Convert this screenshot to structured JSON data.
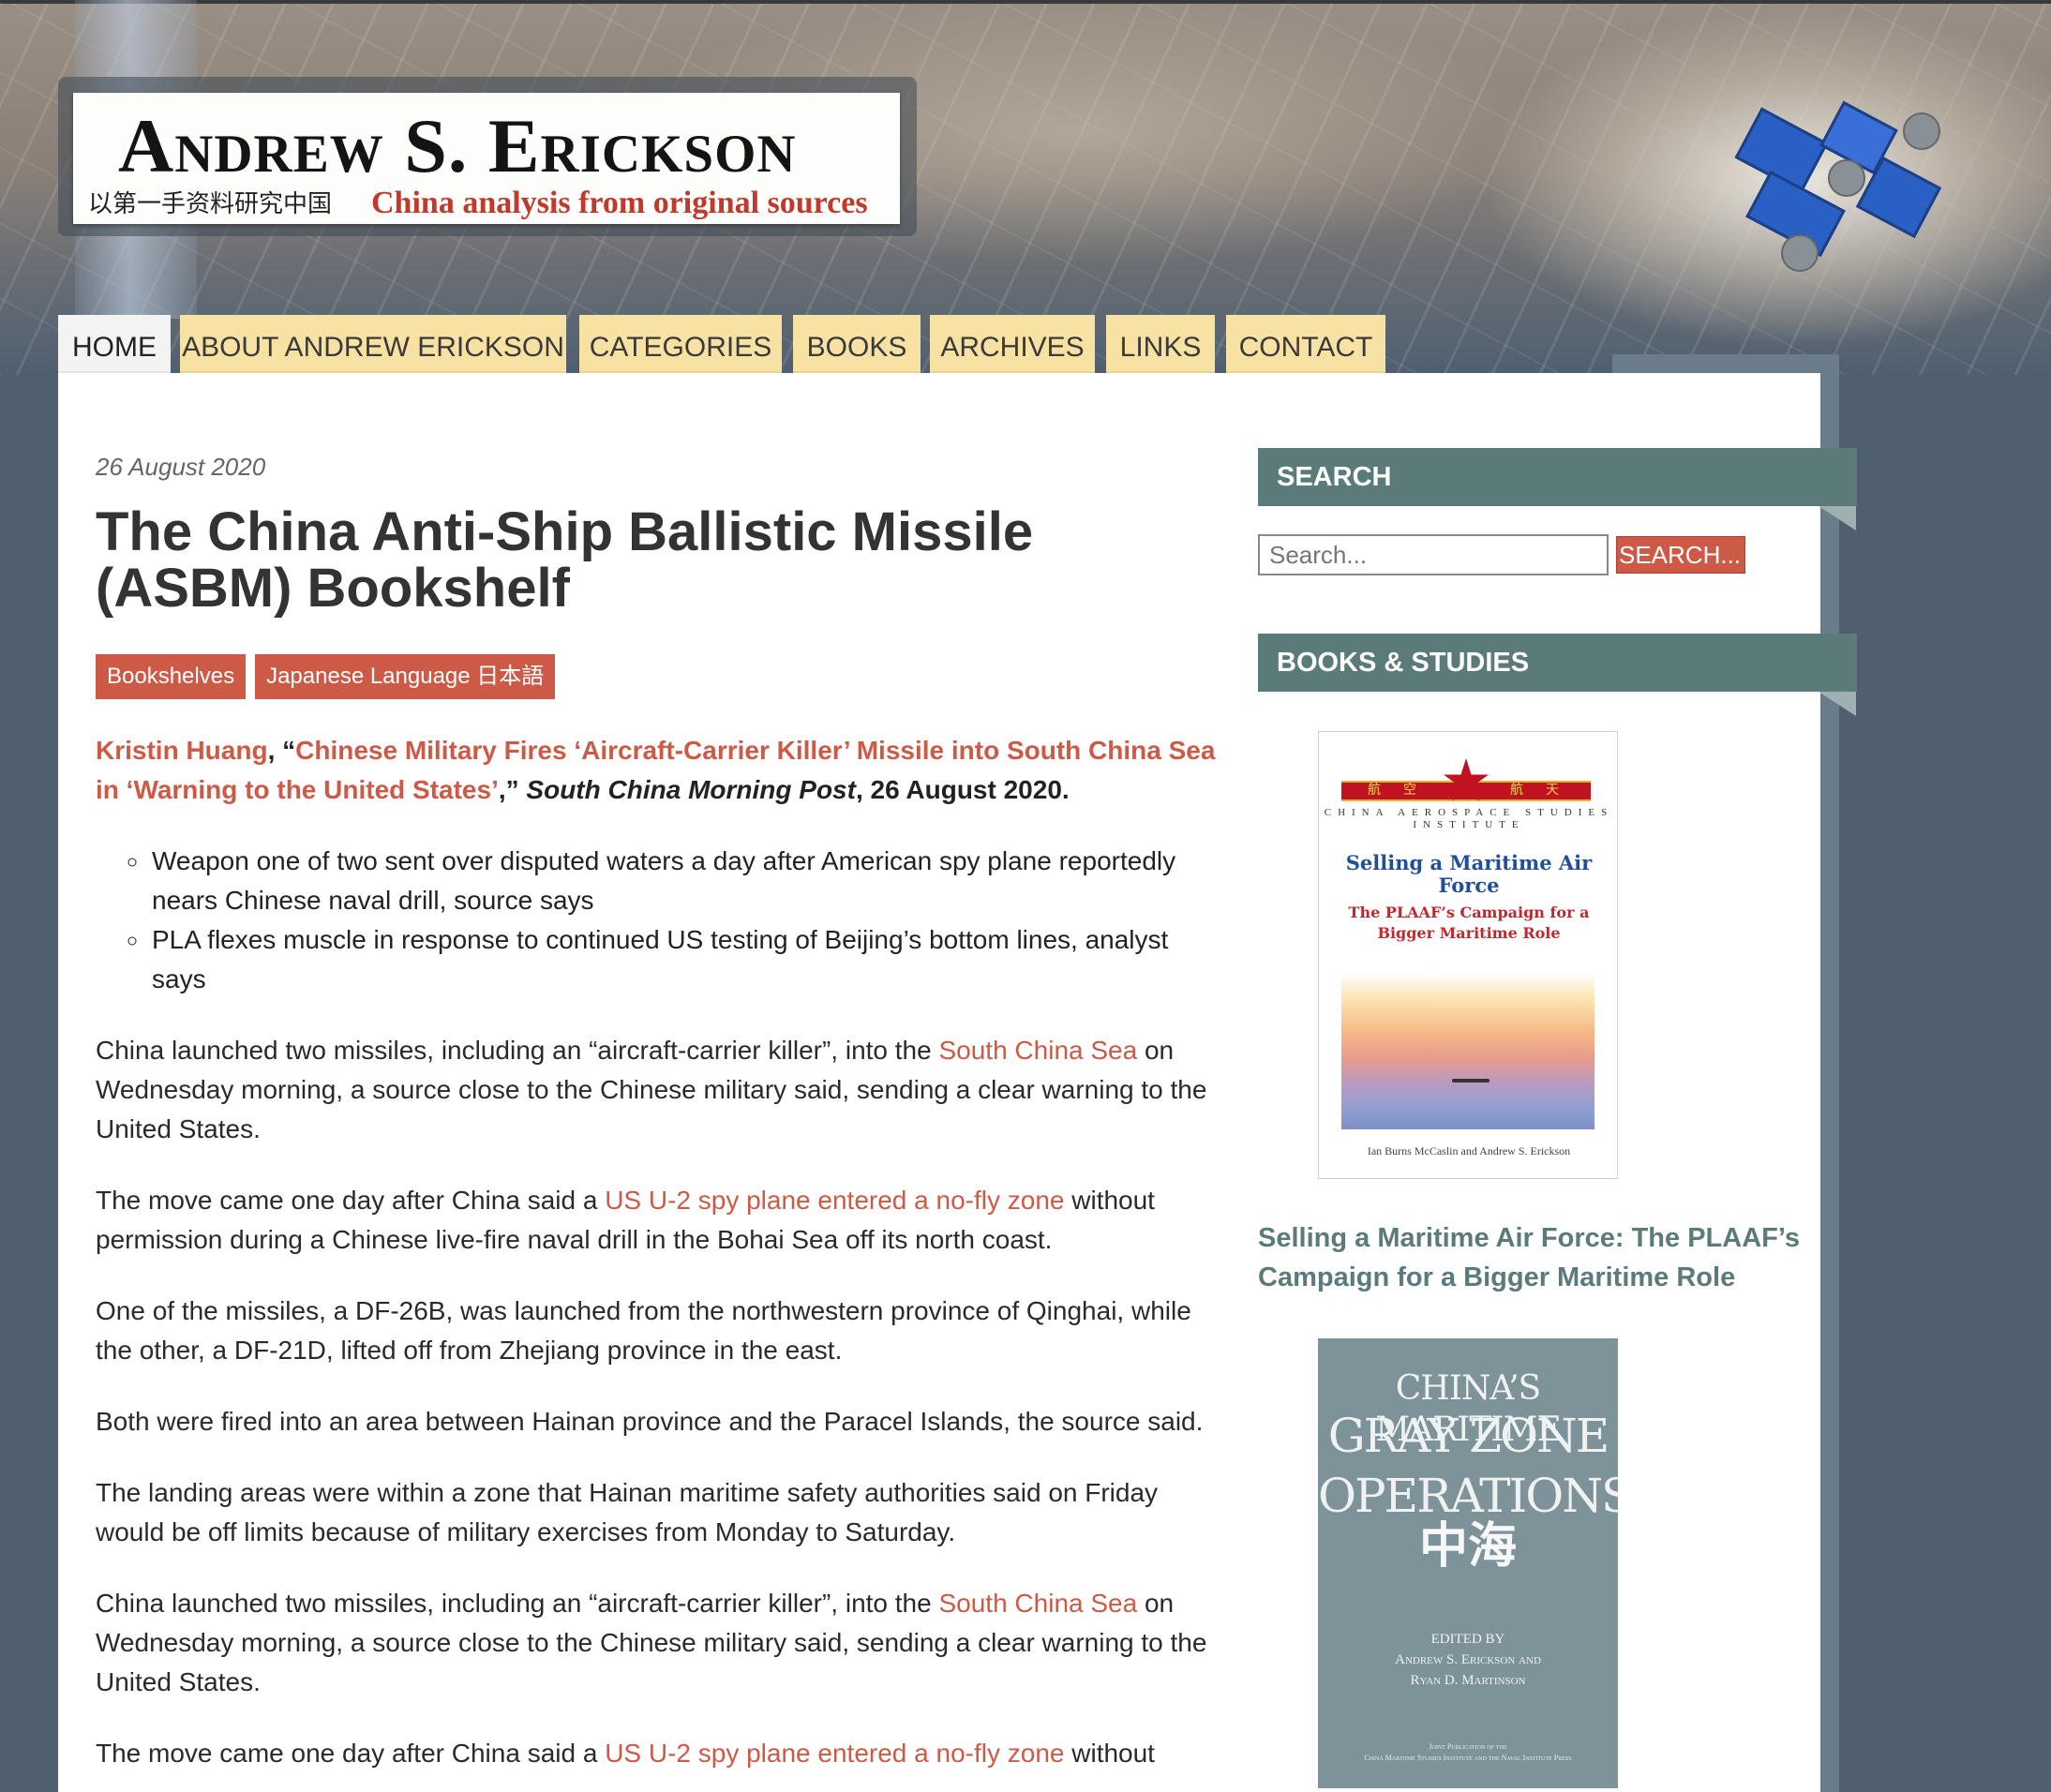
{
  "site": {
    "name": "Andrew S. Erickson",
    "tagline_cn": "以第一手资料研究中国",
    "tagline": "China analysis from original sources"
  },
  "nav": {
    "items": [
      "HOME",
      "ABOUT ANDREW ERICKSON",
      "CATEGORIES",
      "BOOKS",
      "ARCHIVES",
      "LINKS",
      "CONTACT"
    ],
    "active": "HOME"
  },
  "post": {
    "date": "26 August 2020",
    "title": "The China Anti-Ship Ballistic Missile (ASBM) Bookshelf",
    "tags": [
      "Bookshelves",
      "Japanese Language 日本語"
    ],
    "citation": {
      "author": "Kristin Huang",
      "sep1": ", “",
      "article": "Chinese Military Fires ‘Aircraft-Carrier Killer’ Missile into South China Sea in ‘Warning to the United States’",
      "sep2": ",” ",
      "source": "South China Morning Post",
      "date": ", 26 August 2020."
    },
    "bullets": [
      "Weapon one of two sent over disputed waters a day after American spy plane reportedly nears Chinese naval drill, source says",
      "PLA flexes muscle in response to continued US testing of Beijing’s bottom lines, analyst says"
    ],
    "p1": {
      "before": "China launched two missiles, including an “aircraft-carrier killer”, into the ",
      "link": "South China Sea",
      "after": " on Wednesday morning, a source close to the Chinese military said, sending a clear warning to the United States."
    },
    "p2": {
      "before": "The move came one day after China said a ",
      "link": "US U-2 spy plane entered a no-fly zone",
      "after": " without permission during a Chinese live-fire naval drill in the Bohai Sea off its north coast."
    },
    "p3": "One of the missiles, a DF-26B, was launched from the northwestern province of Qinghai, while the other, a DF-21D, lifted off from Zhejiang province in the east.",
    "p4": "Both were fired into an area between Hainan province and the Paracel Islands, the source said.",
    "p5": "The landing areas were within a zone that Hainan maritime safety authorities said on Friday would be off limits because of military exercises from Monday to Saturday.",
    "p6": {
      "before": "China launched two missiles, including an “aircraft-carrier killer”, into the ",
      "link": "South China Sea",
      "after": " on Wednesday morning, a source close to the Chinese military said, sending a clear warning to the United States."
    },
    "p7": {
      "before": "The move came one day after China said a ",
      "link": "US U-2 spy plane entered a no-fly zone",
      "after": " without"
    }
  },
  "sidebar": {
    "search": {
      "title": "SEARCH",
      "placeholder": "Search...",
      "button": "SEARCH..."
    },
    "books": {
      "title": "BOOKS & STUDIES",
      "book1": {
        "band_chars": [
          "航",
          "空",
          "航",
          "天"
        ],
        "institute": "CHINA AEROSPACE STUDIES INSTITUTE",
        "title": "Selling a Maritime Air Force",
        "subtitle": "The PLAAF’s Campaign for a Bigger Maritime Role",
        "authors": "Ian Burns McCaslin and Andrew S. Erickson",
        "caption": "Selling a Maritime Air Force: The PLAAF’s Campaign for a Bigger Maritime Role"
      },
      "book2": {
        "title_line1": "CHINA’S MARITIME",
        "title_line2": "GRAY ZONE OPERATIONS",
        "cn": "中海",
        "editor_line1": "EDITED BY",
        "editor_line2": "Andrew S. Erickson and",
        "editor_line3": "Ryan D. Martinson",
        "footer1": "Joint Publication of the",
        "footer2": "China Maritime Studies Institute and the Naval Institute Press"
      }
    }
  },
  "colors": {
    "accent": "#cd5a47",
    "widget": "#5a7b7a",
    "nav_tab": "#f7e2a3",
    "page_bg": "#4f5f70"
  }
}
